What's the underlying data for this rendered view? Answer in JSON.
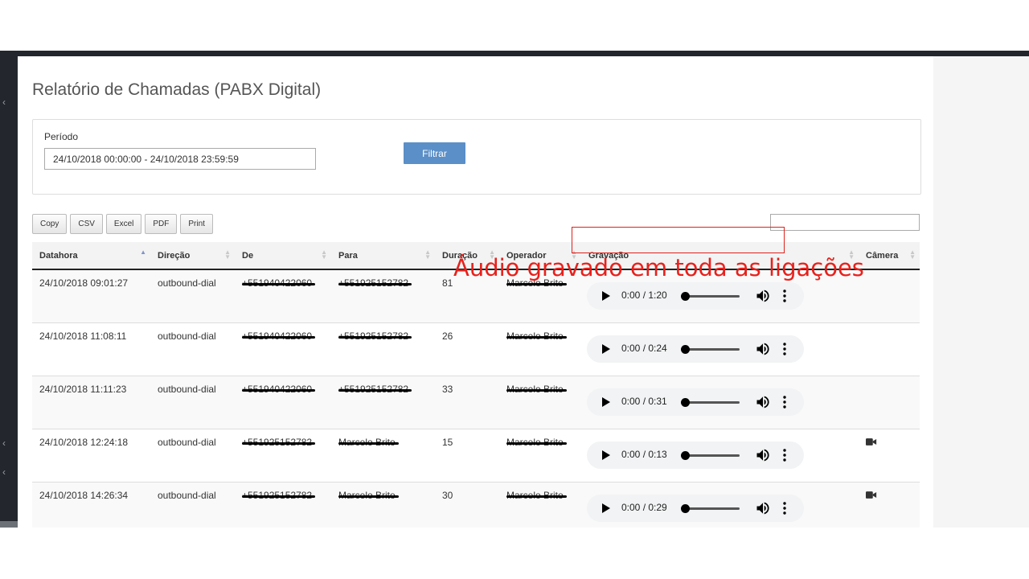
{
  "page": {
    "title": "Relatório de Chamadas (PABX Digital)"
  },
  "filter": {
    "period_label": "Período",
    "period_value": "24/10/2018 00:00:00 - 24/10/2018 23:59:59",
    "button_label": "Filtrar"
  },
  "export_buttons": [
    "Copy",
    "CSV",
    "Excel",
    "PDF",
    "Print"
  ],
  "search": {
    "value": ""
  },
  "table": {
    "columns": [
      "Datahora",
      "Direção",
      "De",
      "Para",
      "Duração",
      "Operador",
      "Gravação",
      "Câmera"
    ],
    "sorted_column": "Datahora",
    "rows": [
      {
        "datahora": "24/10/2018 09:01:27",
        "direcao": "outbound-dial",
        "de": "+551940422060",
        "para": "+551925152782",
        "duracao": "81",
        "operador": "Marcelo Brito",
        "gravacao": "0:00 / 1:20",
        "camera": false
      },
      {
        "datahora": "24/10/2018 11:08:11",
        "direcao": "outbound-dial",
        "de": "+551940422060",
        "para": "+551925152782",
        "duracao": "26",
        "operador": "Marcelo Brito",
        "gravacao": "0:00 / 0:24",
        "camera": false
      },
      {
        "datahora": "24/10/2018 11:11:23",
        "direcao": "outbound-dial",
        "de": "+551940422060",
        "para": "+551925152782",
        "duracao": "33",
        "operador": "Marcelo Brito",
        "gravacao": "0:00 / 0:31",
        "camera": false
      },
      {
        "datahora": "24/10/2018 12:24:18",
        "direcao": "outbound-dial",
        "de": "+551925152782",
        "para": "Marcelo Brito",
        "duracao": "15",
        "operador": "Marcelo Brito",
        "gravacao": "0:00 / 0:13",
        "camera": true
      },
      {
        "datahora": "24/10/2018 14:26:34",
        "direcao": "outbound-dial",
        "de": "+551925152782",
        "para": "Marcelo Brito",
        "duracao": "30",
        "operador": "Marcelo Brito",
        "gravacao": "0:00 / 0:29",
        "camera": true
      }
    ]
  },
  "annotation": {
    "text": "Áudio gravado em toda as ligações",
    "color": "#e8211c"
  },
  "icons": {
    "play": "play-icon",
    "volume": "volume-icon",
    "more": "more-vert-icon",
    "camera": "video-camera-icon",
    "rail": "chevron-left-icon"
  },
  "colors": {
    "accent_button": "#5b8fc7",
    "annotation": "#e8211c",
    "sidebar": "#23272d"
  }
}
